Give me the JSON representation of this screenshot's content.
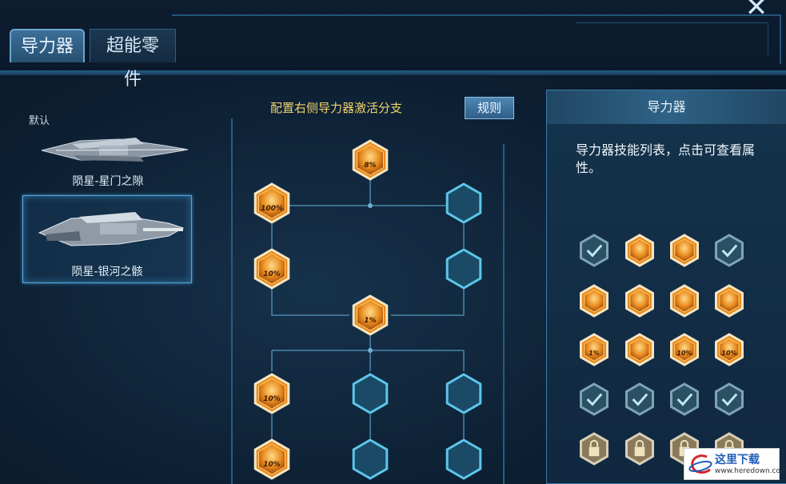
{
  "header": {
    "close_label": "✕",
    "tabs": [
      {
        "label": "导力器",
        "active": true
      },
      {
        "label": "超能零件",
        "active": false
      }
    ]
  },
  "ships": {
    "default_label": "默认",
    "items": [
      {
        "name": "陨星-星门之隙",
        "selected": false
      },
      {
        "name": "陨星-银河之骸",
        "selected": true
      }
    ]
  },
  "tree": {
    "header": "配置右侧导力器激活分支",
    "rules_button": "规则",
    "nodes": [
      {
        "id": "top",
        "label": "8%",
        "state": "active"
      },
      {
        "id": "r1-left",
        "label": "100%",
        "state": "active"
      },
      {
        "id": "r1-right",
        "label": "",
        "state": "empty"
      },
      {
        "id": "r2-left",
        "label": "10%",
        "state": "active"
      },
      {
        "id": "r2-right",
        "label": "",
        "state": "empty"
      },
      {
        "id": "mid",
        "label": "1%",
        "state": "active"
      },
      {
        "id": "r3-left",
        "label": "10%",
        "state": "active"
      },
      {
        "id": "r3-mid",
        "label": "",
        "state": "empty"
      },
      {
        "id": "r3-right",
        "label": "",
        "state": "empty"
      },
      {
        "id": "r4-left",
        "label": "10%",
        "state": "active"
      },
      {
        "id": "r4-mid",
        "label": "",
        "state": "empty"
      },
      {
        "id": "r4-right",
        "label": "",
        "state": "empty"
      }
    ]
  },
  "skill_panel": {
    "title": "导力器",
    "description": "导力器技能列表，点击可查看属性。",
    "skills": [
      {
        "state": "checked",
        "label": ""
      },
      {
        "state": "active",
        "label": ""
      },
      {
        "state": "active",
        "label": ""
      },
      {
        "state": "checked",
        "label": ""
      },
      {
        "state": "active",
        "label": ""
      },
      {
        "state": "active",
        "label": ""
      },
      {
        "state": "active",
        "label": ""
      },
      {
        "state": "active",
        "label": ""
      },
      {
        "state": "active",
        "label": "1%"
      },
      {
        "state": "active",
        "label": ""
      },
      {
        "state": "active",
        "label": "10%"
      },
      {
        "state": "active",
        "label": "10%"
      },
      {
        "state": "checked",
        "label": ""
      },
      {
        "state": "checked",
        "label": ""
      },
      {
        "state": "checked",
        "label": ""
      },
      {
        "state": "checked",
        "label": ""
      },
      {
        "state": "locked",
        "label": ""
      },
      {
        "state": "locked",
        "label": ""
      },
      {
        "state": "locked",
        "label": ""
      },
      {
        "state": "locked",
        "label": ""
      }
    ]
  },
  "watermark": {
    "name": "这里下载",
    "url": "www.heredown.com"
  },
  "colors": {
    "accent_gold": "#f0d36a",
    "node_orange": "#e88a1c",
    "node_empty": "#1a4a66",
    "panel_border": "#3d7aa6"
  }
}
